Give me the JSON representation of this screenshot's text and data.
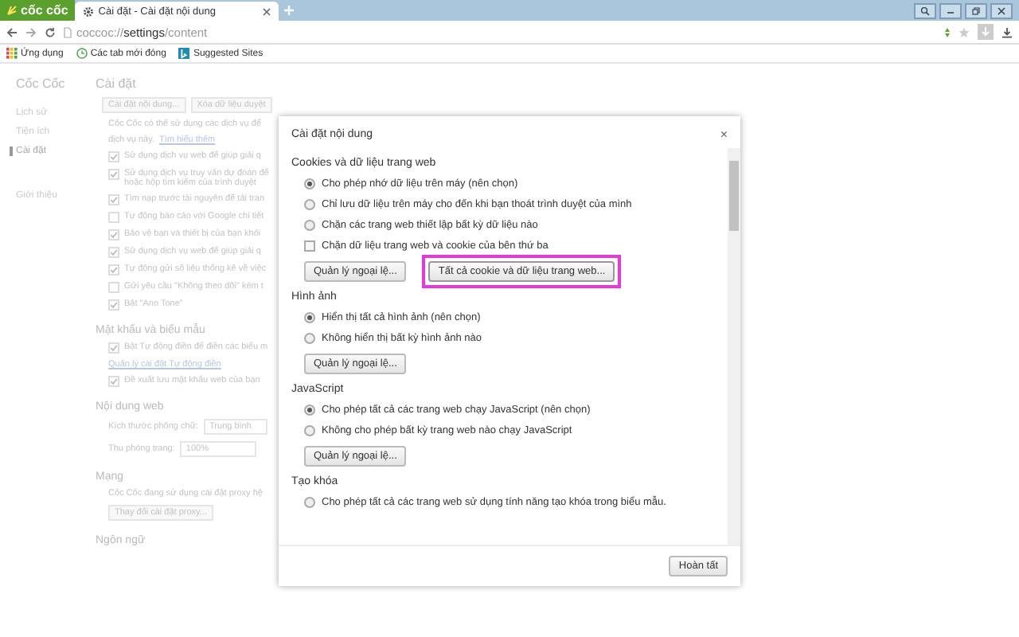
{
  "browser": {
    "logo": "cốc cốc",
    "tabs": [
      {
        "label": "Cài đặt - Cài đặt nội dung",
        "selected": true
      }
    ],
    "url": "coccoc://**settings**/content",
    "bookmarks": [
      {
        "kind": "apps",
        "label": "Ứng dụng"
      },
      {
        "kind": "history",
        "label": "Các tab mới đóng"
      },
      {
        "kind": "bing",
        "label": "Suggested Sites"
      }
    ]
  },
  "settings_page": {
    "sidebar": {
      "title": "Cốc Cốc",
      "items": [
        {
          "label": "Lịch sử",
          "selected": false
        },
        {
          "label": "Tiện ích",
          "selected": false
        },
        {
          "label": "Cài đặt",
          "selected": true
        },
        {
          "label": "Giới thiệu",
          "selected": false
        }
      ]
    },
    "title": "Cài đặt",
    "sections": [
      {
        "items": [
          {
            "kind": "buttons",
            "labels": [
              "Cài đặt nội dung...",
              "Xóa dữ liệu duyệt"
            ]
          },
          {
            "kind": "text",
            "text": "Cốc Cốc có thể sử dụng các dịch vụ để"
          },
          {
            "kind": "text_link",
            "text": "dịch vụ này.",
            "link": "Tìm hiểu thêm"
          },
          {
            "kind": "checkbox",
            "label": "Sử dụng dịch vụ web để giúp giải q",
            "checked": true
          },
          {
            "kind": "checkbox",
            "label": "Sử dụng dịch vụ truy vấn dự đoán để",
            "detail": "hoặc hộp tìm kiếm của trình duyệt",
            "checked": true
          },
          {
            "kind": "checkbox",
            "label": "Tìm nạp trước tài nguyên để tải tran",
            "checked": true
          },
          {
            "kind": "checkbox",
            "label": "Tự động báo cáo với Google chi tiết",
            "checked": false
          },
          {
            "kind": "checkbox",
            "label": "Bảo vệ bạn và thiết bị của bạn khỏi",
            "checked": true
          },
          {
            "kind": "checkbox",
            "label": "Sử dụng dịch vụ web để giúp giải q",
            "checked": true
          },
          {
            "kind": "checkbox",
            "label": "Tự động gửi số liệu thống kê về việc",
            "checked": true
          },
          {
            "kind": "checkbox",
            "label": "Gửi yêu cầu \"Không theo dõi\" kèm t",
            "checked": false
          },
          {
            "kind": "checkbox",
            "label": "Bật \"Ano Tone\"",
            "checked": true
          }
        ]
      },
      {
        "title": "Mật khẩu và biểu mẫu",
        "items": [
          {
            "kind": "checkbox",
            "label": "Bật Tự động điền để điền các biểu m",
            "checked": true
          },
          {
            "kind": "link",
            "link": "Quản lý cài đặt Tự động điền"
          },
          {
            "kind": "checkbox",
            "label": "Đề xuất lưu mật khẩu web của bạn",
            "checked": true
          }
        ]
      },
      {
        "title": "Nội dung web",
        "items": [
          {
            "kind": "select",
            "label": "Kích thước phông chữ:",
            "value": "Trung bình"
          },
          {
            "kind": "select",
            "label": "Thu phóng trang:",
            "value": "100%"
          }
        ]
      },
      {
        "title": "Mạng",
        "items": [
          {
            "kind": "text",
            "text": "Cốc Cốc đang sử dụng cài đặt proxy hệ"
          },
          {
            "kind": "buttons",
            "labels": [
              "Thay đổi cài đặt proxy..."
            ]
          }
        ]
      },
      {
        "title": "Ngôn ngữ"
      }
    ]
  },
  "dialog": {
    "title": "Cài đặt nội dung",
    "close": "×",
    "sections": [
      {
        "title": "Cookies và dữ liệu trang web",
        "options": [
          {
            "kind": "radio",
            "label": "Cho phép nhớ dữ liệu trên máy (nên chọn)",
            "selected": true
          },
          {
            "kind": "radio",
            "label": "Chỉ lưu dữ liệu trên máy cho đến khi bạn thoát trình duyệt của mình",
            "selected": false
          },
          {
            "kind": "radio",
            "label": "Chặn các trang web thiết lập bất kỳ dữ liệu nào",
            "selected": false
          },
          {
            "kind": "checkbox",
            "label": "Chặn dữ liệu trang web và cookie của bên thứ ba",
            "checked": false
          }
        ],
        "buttons": [
          {
            "label": "Quản lý ngoại lệ...",
            "highlighted": false
          },
          {
            "label": "Tất cả cookie và dữ liệu trang web...",
            "highlighted": true
          }
        ]
      },
      {
        "title": "Hình ảnh",
        "options": [
          {
            "kind": "radio",
            "label": "Hiển thị tất cả hình ảnh (nên chọn)",
            "selected": true
          },
          {
            "kind": "radio",
            "label": "Không hiển thị bất kỳ hình ảnh nào",
            "selected": false
          }
        ],
        "buttons": [
          {
            "label": "Quản lý ngoại lệ...",
            "highlighted": false
          }
        ]
      },
      {
        "title": "JavaScript",
        "options": [
          {
            "kind": "radio",
            "label": "Cho phép tất cả các trang web chạy JavaScript (nên chọn)",
            "selected": true
          },
          {
            "kind": "radio",
            "label": "Không cho phép bất kỳ trang web nào chạy JavaScript",
            "selected": false
          }
        ],
        "buttons": [
          {
            "label": "Quản lý ngoại lệ...",
            "highlighted": false
          }
        ]
      },
      {
        "title": "Tạo khóa",
        "options": [
          {
            "kind": "radio",
            "label": "Cho phép tất cả các trang web sử dụng tính năng tạo khóa trong biểu mẫu.",
            "selected": false
          }
        ]
      }
    ],
    "done": "Hoàn tất"
  }
}
